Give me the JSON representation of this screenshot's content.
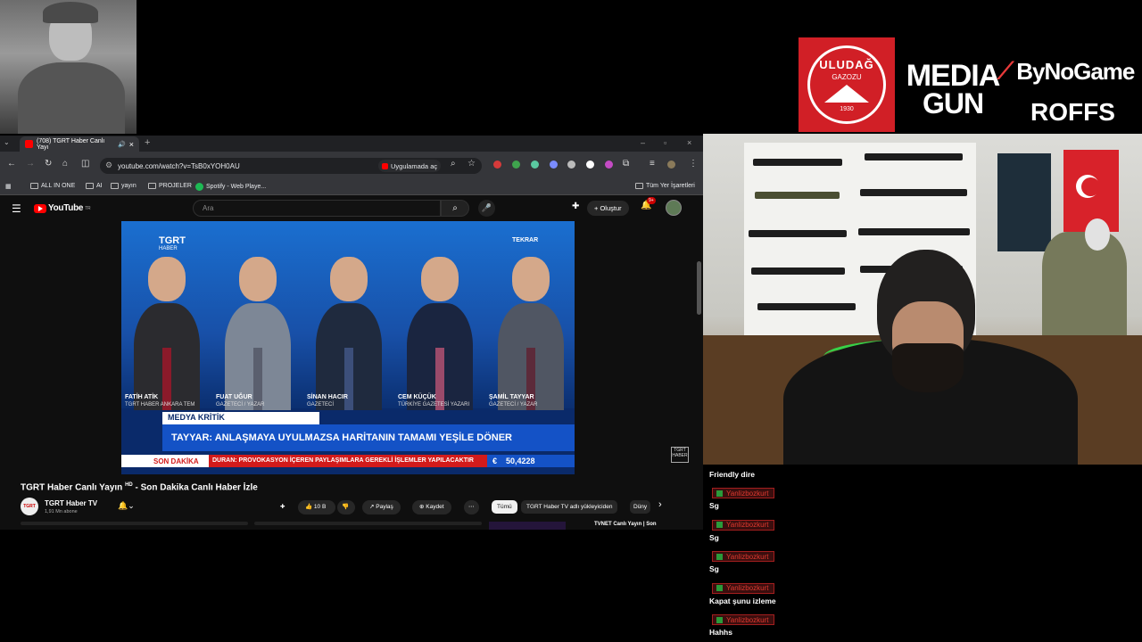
{
  "browser": {
    "tab_title": "(708) TGRT Haber Canlı Yayı",
    "url": "youtube.com/watch?v=TsB0xYOH0AU",
    "open_in_app": "Uygulamada aç",
    "bookmarks": [
      "ALL IN ONE",
      "AI",
      "yayın",
      "PROJELER",
      "Spotify - Web Playe..."
    ],
    "all_bookmarks": "Tüm Yer İşaretleri"
  },
  "youtube": {
    "logo": "YouTube",
    "logo_country": "TR",
    "search_placeholder": "Ara",
    "create_label": "Oluştur",
    "notification_count": "9+",
    "video_title": "TGRT Haber Canlı Yayın",
    "video_title_badge": "HD",
    "video_title_rest": " - Son Dakika Canlı Haber İzle",
    "channel_name": "TGRT Haber TV",
    "channel_avatar_text": "TGRT HABER",
    "subscribers": "1,91 Mn abone",
    "likes": "10 B",
    "share_label": "Paylaş",
    "save_label": "Kaydet",
    "filter_all": "Tümü",
    "filter_channel": "TGRT Haber TV adlı yükleyiciden",
    "filter_more": "Düny",
    "rec_title": "TVNET Canlı Yayın | Son"
  },
  "video": {
    "channel_logo": "TGRT",
    "channel_logo_sub": "HABER",
    "replay_label": "TEKRAR",
    "panelists": [
      {
        "name": "FATİH ATİK",
        "role": "TGRT HABER ANKARA TEM",
        "suit": "#2b2b2f",
        "tie": "#8b1a2a"
      },
      {
        "name": "FUAT UĞUR",
        "role": "GAZETECİ / YAZAR",
        "suit": "#7d8796",
        "tie": "#5a5f6e"
      },
      {
        "name": "SİNAN HACIR",
        "role": "GAZETECİ",
        "suit": "#1f2a3e",
        "tie": "#3c4f7a"
      },
      {
        "name": "CEM KÜÇÜK",
        "role": "TÜRKİYE GAZETESİ YAZARI",
        "suit": "#1a2540",
        "tie": "#9a4a6a"
      },
      {
        "name": "ŞAMİL TAYYAR",
        "role": "GAZETECİ / YAZAR",
        "suit": "#505663",
        "tie": "#5c2a3a"
      }
    ],
    "segment": "MEDYA KRİTİK",
    "headline": "TAYYAR: ANLAŞMAYA UYULMAZSA HARİTANIN TAMAMI YEŞİLE DÖNER",
    "breaking_label": "SON DAKİKA",
    "ticker_text": "DURAN: PROVOKASYON İÇEREN PAYLAŞIMLARA GEREKLİ İŞLEMLER YAPILACAKTIR",
    "currency_symbol": "€",
    "currency_value": "50,4228",
    "watermark": "TGRT HABER"
  },
  "sponsors": {
    "uludag": "ULUDAĞ",
    "uludag_sub": "GAZOZU",
    "uludag_year": "1930",
    "mediagun_1": "MEDIA",
    "mediagun_2": "GUN",
    "bynogame": "ByNoGame",
    "roffs": "ROFFS"
  },
  "chat": {
    "first_text": "Friendly dire",
    "messages": [
      {
        "user": "Yanlizbozkurt",
        "text": "Sg"
      },
      {
        "user": "Yanlizbozkurt",
        "text": "Sg"
      },
      {
        "user": "Yanlizbozkurt",
        "text": "Sg"
      },
      {
        "user": "Yanlizbozkurt",
        "text": "Kapat şunu izleme"
      },
      {
        "user": "Yanlizbozkurt",
        "text": "Hahhs"
      }
    ]
  },
  "colors": {
    "youtube_red": "#ff0000",
    "news_blue": "#1452c6",
    "breaking_red": "#d21b1b",
    "chat_user_red": "#e0392f"
  }
}
